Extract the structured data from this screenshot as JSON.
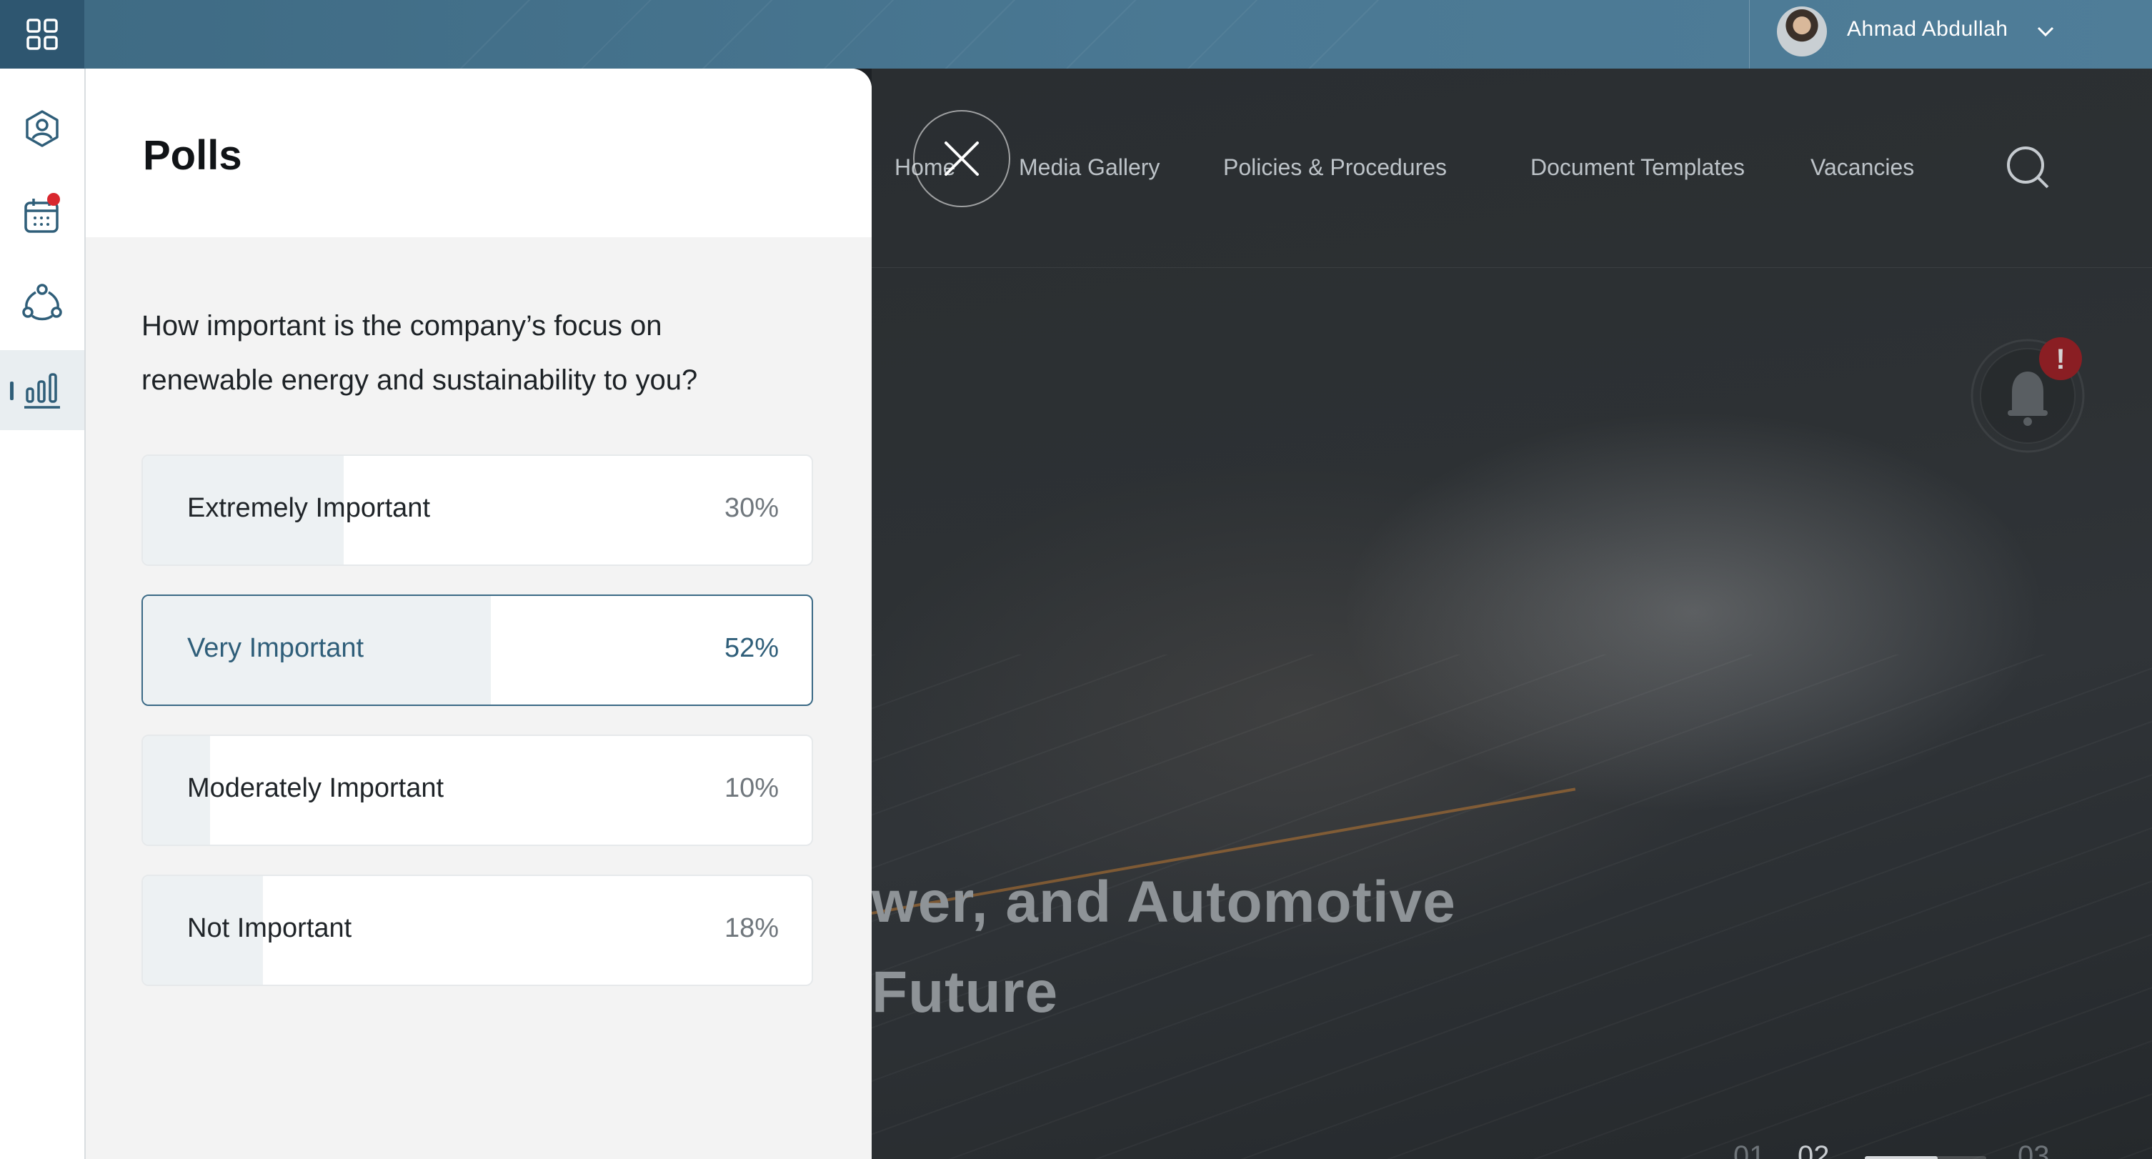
{
  "topbar": {
    "user_name": "Ahmad Abdullah"
  },
  "rail": {
    "items": [
      {
        "icon": "profile-icon"
      },
      {
        "icon": "calendar-icon",
        "has_notification": true
      },
      {
        "icon": "network-icon"
      },
      {
        "icon": "bar-chart-icon",
        "active": true
      }
    ]
  },
  "hero": {
    "nav": [
      "Home",
      "Media Gallery",
      "Policies & Procedures",
      "Document Templates",
      "Vacancies"
    ],
    "title_line1": "wer, and Automotive",
    "title_line2": "Future",
    "slides": [
      "01",
      "02",
      "03"
    ],
    "current_slide": "02",
    "slide_progress": 0.6
  },
  "polls": {
    "title": "Polls",
    "question": "How important is the company’s focus on renewable energy and sustainability to you?",
    "options": [
      {
        "label": "Extremely Important",
        "percent": "30%",
        "value": 0.3,
        "selected": false
      },
      {
        "label": "Very Important",
        "percent": "52%",
        "value": 0.52,
        "selected": true
      },
      {
        "label": "Moderately Important",
        "percent": "10%",
        "value": 0.1,
        "selected": false
      },
      {
        "label": "Not Important",
        "percent": "18%",
        "value": 0.18,
        "selected": false
      }
    ]
  },
  "colors": {
    "accent": "#2f5e79",
    "notification": "#d9272e",
    "topbar": "#4a7893"
  }
}
